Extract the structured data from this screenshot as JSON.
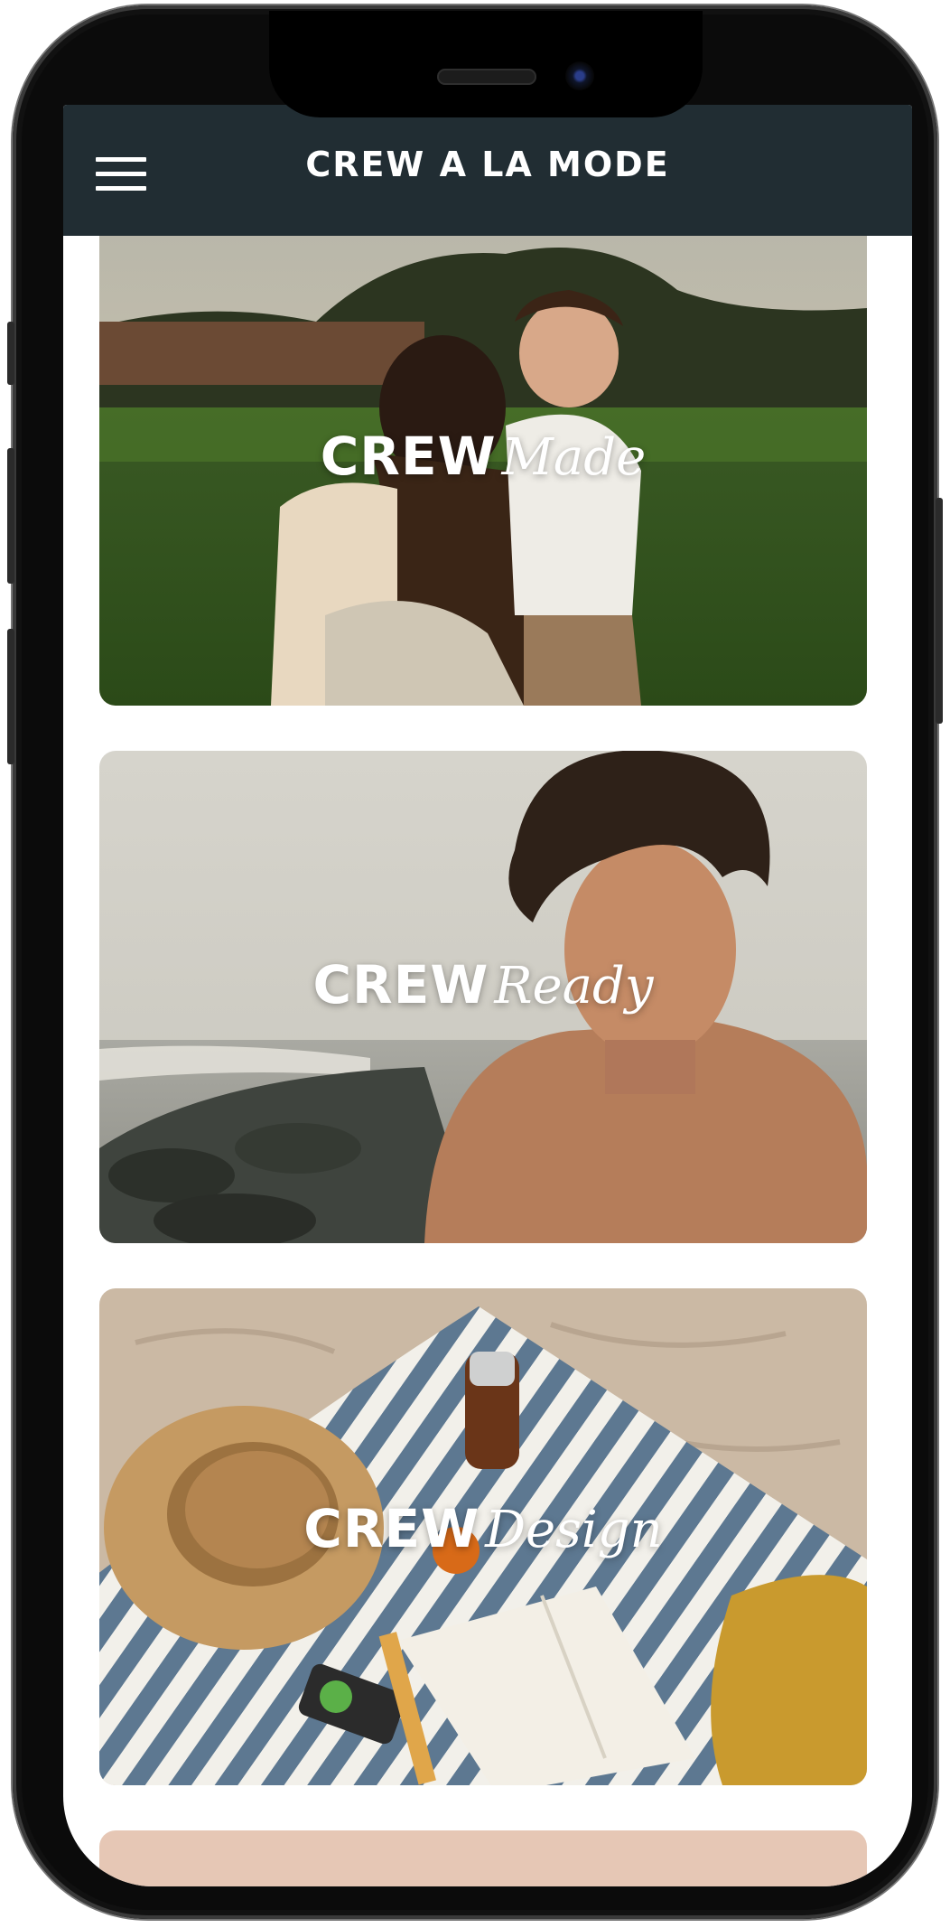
{
  "app": {
    "title": "CREW A LA MODE"
  },
  "cards": [
    {
      "word1": "CREW",
      "word2": "Made",
      "image": "couple-on-grass"
    },
    {
      "word1": "CREW",
      "word2": "Ready",
      "image": "man-by-the-sea"
    },
    {
      "word1": "CREW",
      "word2": "Design",
      "image": "beach-blanket-with-hat-and-book"
    },
    {
      "image": "partially-visible-card"
    }
  ],
  "icons": {
    "menu": "hamburger-menu-icon"
  },
  "colors": {
    "header": "#212d33",
    "screen": "#ffffff",
    "header_text": "#ffffff"
  }
}
